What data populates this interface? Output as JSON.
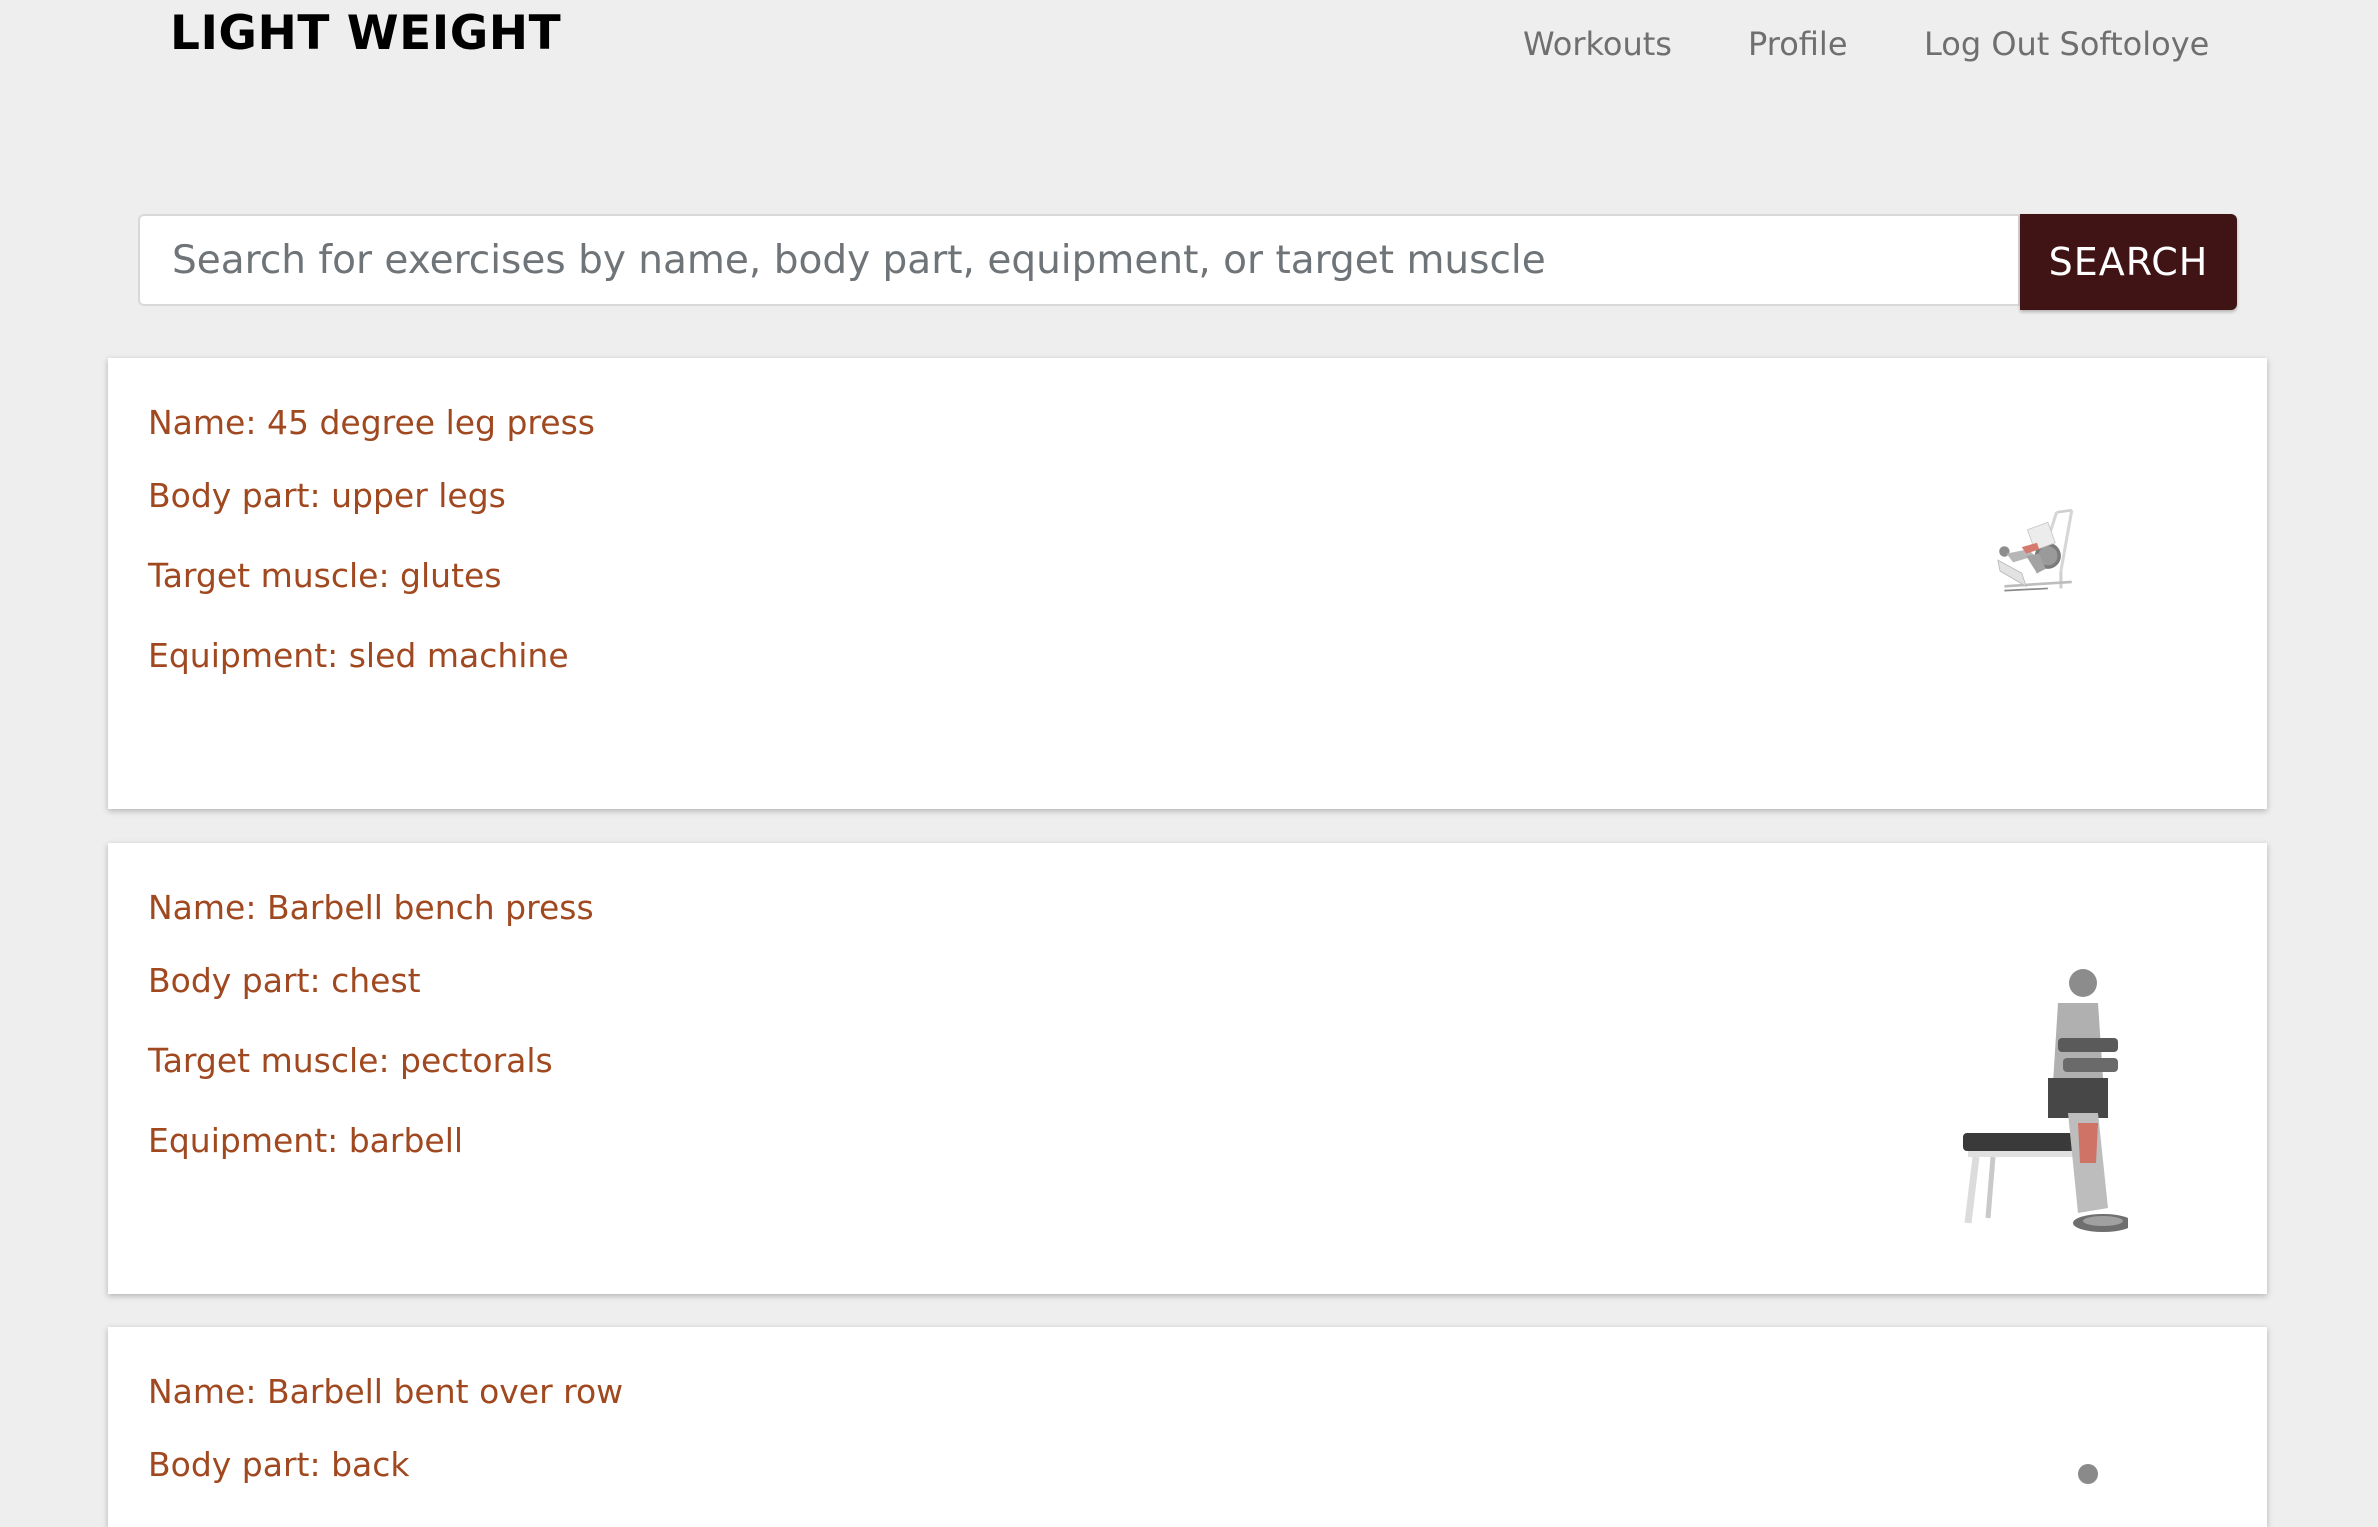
{
  "header": {
    "brand": "LIGHT WEIGHT",
    "nav": [
      "Workouts",
      "Profile",
      "Log Out Softoloye"
    ]
  },
  "search": {
    "placeholder": "Search for exercises by name, body part, equipment, or target muscle",
    "value": "",
    "button_label": "SEARCH"
  },
  "exercises": [
    {
      "name": "Name: 45 degree leg press",
      "body_part": "Body part: upper legs",
      "target": "Target muscle: glutes",
      "equipment": "Equipment: sled machine",
      "image_icon": "leg-press-illustration"
    },
    {
      "name": "Name: Barbell bench press",
      "body_part": "Body part: chest",
      "target": "Target muscle: pectorals",
      "equipment": "Equipment: barbell",
      "image_icon": "seated-dumbbell-illustration"
    },
    {
      "name": "Name: Barbell bent over row",
      "body_part": "Body part: back",
      "image_icon": "bent-over-row-illustration"
    }
  ],
  "colors": {
    "background": "#eeeeee",
    "accent_text": "#a0481f",
    "button": "#401414",
    "nav_text": "#6f6f6f"
  }
}
